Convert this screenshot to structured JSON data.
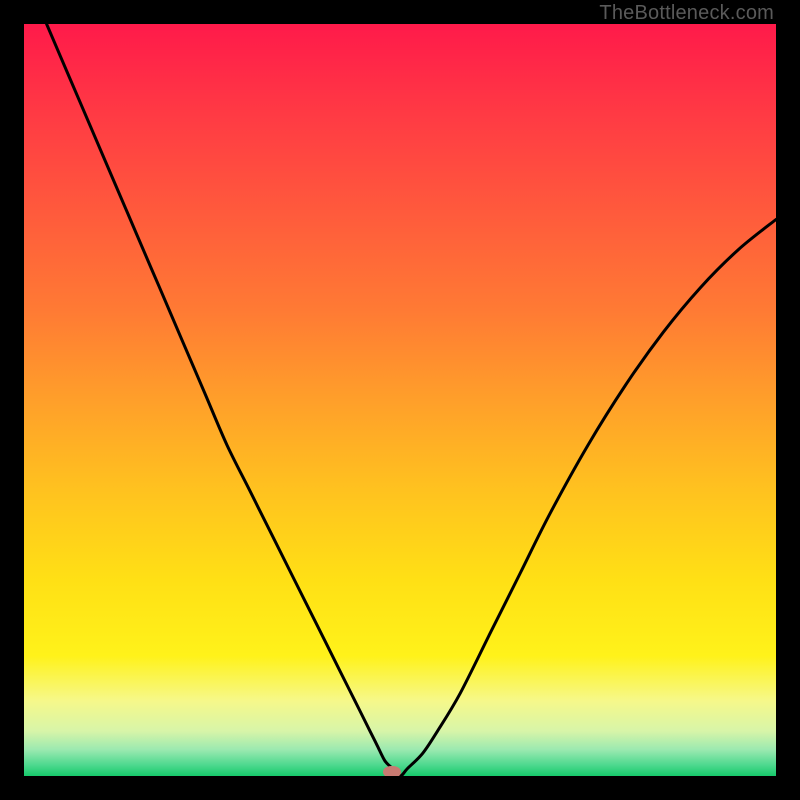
{
  "watermark": {
    "text": "TheBottleneck.com"
  },
  "chart_data": {
    "type": "line",
    "title": "",
    "xlabel": "",
    "ylabel": "",
    "xlim": [
      0,
      100
    ],
    "ylim": [
      0,
      100
    ],
    "grid": false,
    "legend": false,
    "series": [
      {
        "name": "bottleneck-curve",
        "x": [
          3,
          6,
          9,
          12,
          15,
          18,
          21,
          24,
          27,
          30,
          33,
          36,
          39,
          42,
          44,
          46,
          47,
          48,
          49,
          50,
          51,
          53,
          55,
          58,
          62,
          66,
          70,
          75,
          80,
          85,
          90,
          95,
          100
        ],
        "y": [
          100,
          93,
          86,
          79,
          72,
          65,
          58,
          51,
          44,
          38,
          32,
          26,
          20,
          14,
          10,
          6,
          4,
          2,
          1,
          0,
          1,
          3,
          6,
          11,
          19,
          27,
          35,
          44,
          52,
          59,
          65,
          70,
          74
        ]
      }
    ],
    "marker": {
      "x": 49,
      "y": 0.5,
      "color": "#c87a72"
    },
    "background_gradient": {
      "stops": [
        {
          "offset": 0.0,
          "color": "#ff1a4a"
        },
        {
          "offset": 0.12,
          "color": "#ff3a44"
        },
        {
          "offset": 0.25,
          "color": "#ff5a3c"
        },
        {
          "offset": 0.38,
          "color": "#ff7a34"
        },
        {
          "offset": 0.5,
          "color": "#ff9f2a"
        },
        {
          "offset": 0.62,
          "color": "#ffc21f"
        },
        {
          "offset": 0.74,
          "color": "#ffe015"
        },
        {
          "offset": 0.84,
          "color": "#fff21a"
        },
        {
          "offset": 0.9,
          "color": "#f6f88a"
        },
        {
          "offset": 0.94,
          "color": "#d8f5a8"
        },
        {
          "offset": 0.965,
          "color": "#9be9b0"
        },
        {
          "offset": 0.985,
          "color": "#4fd98f"
        },
        {
          "offset": 1.0,
          "color": "#17c96b"
        }
      ]
    }
  }
}
